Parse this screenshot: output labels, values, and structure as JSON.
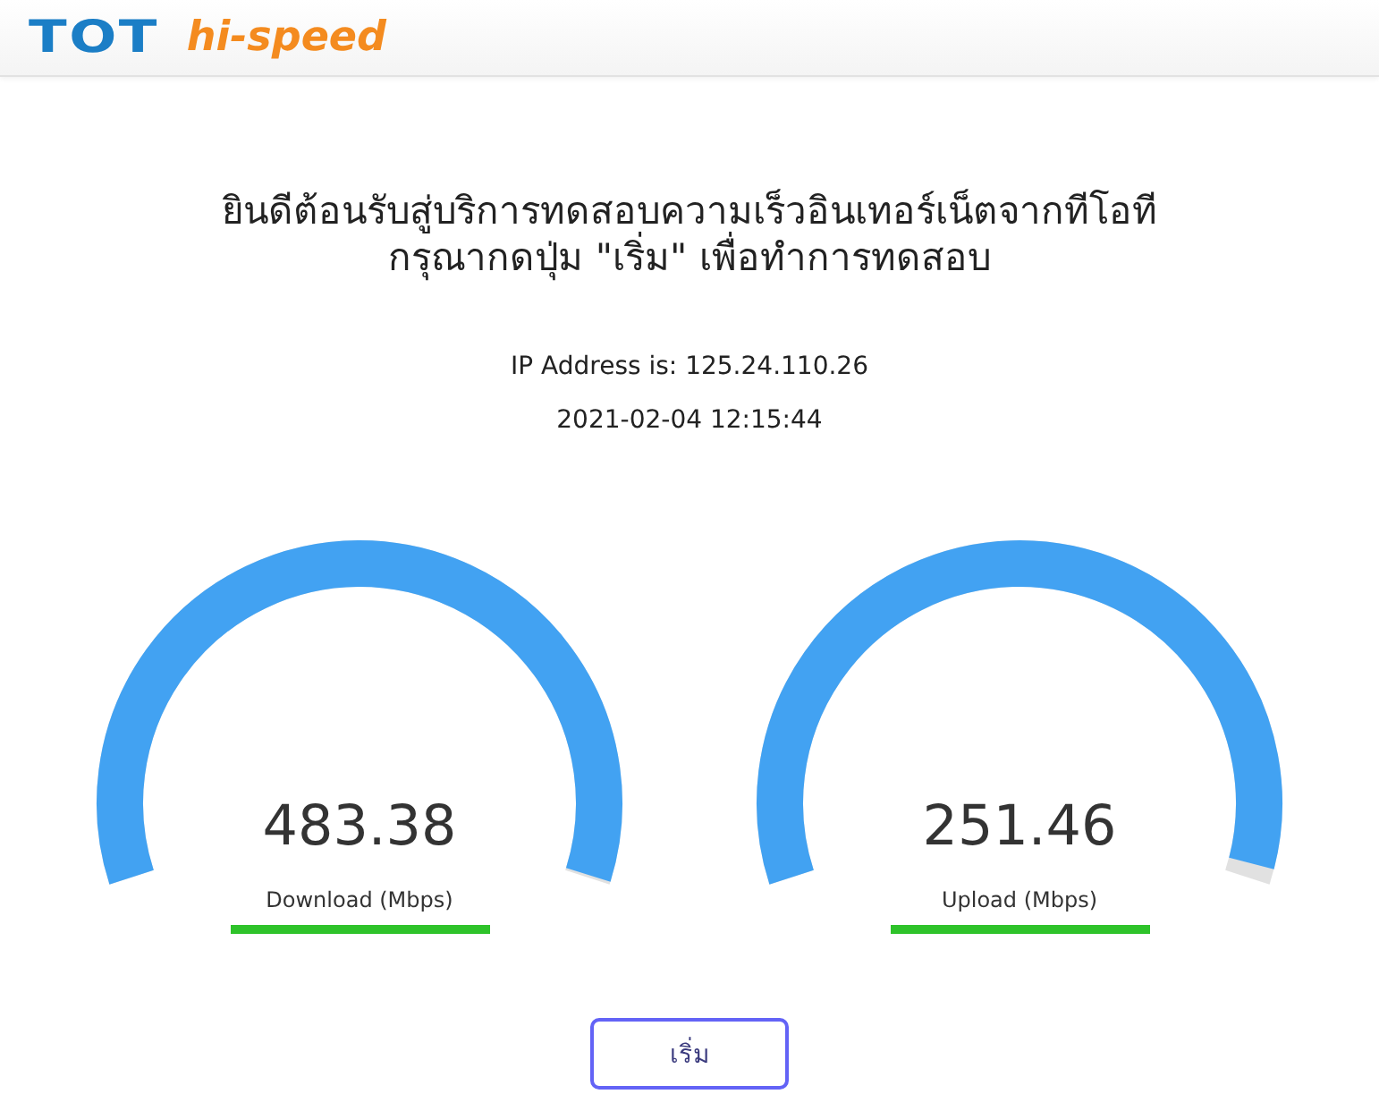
{
  "header": {
    "logo_mark": "TOT",
    "logo_text": "hi-speed"
  },
  "welcome": {
    "lines": [
      "ยินดีต้อนรับสู่บริการทดสอบความเร็วอินเทอร์เน็ตจากทีโอที",
      "กรุณากดปุ่ม \"เริ่ม\" เพื่อทำการทดสอบ"
    ]
  },
  "connection": {
    "ip_address": "IP Address is: 125.24.110.26",
    "timestamp": "2021-02-04 12:15:44"
  },
  "gauges": [
    {
      "value": "483.38",
      "label": "Download (Mbps)",
      "level": 0.997,
      "progress": {
        "level": 1
      }
    },
    {
      "value": "251.46",
      "label": "Upload (Mbps)",
      "level": 0.984,
      "progress": {
        "level": 1
      }
    }
  ],
  "start_button": {
    "label": "เริ่ม"
  }
}
